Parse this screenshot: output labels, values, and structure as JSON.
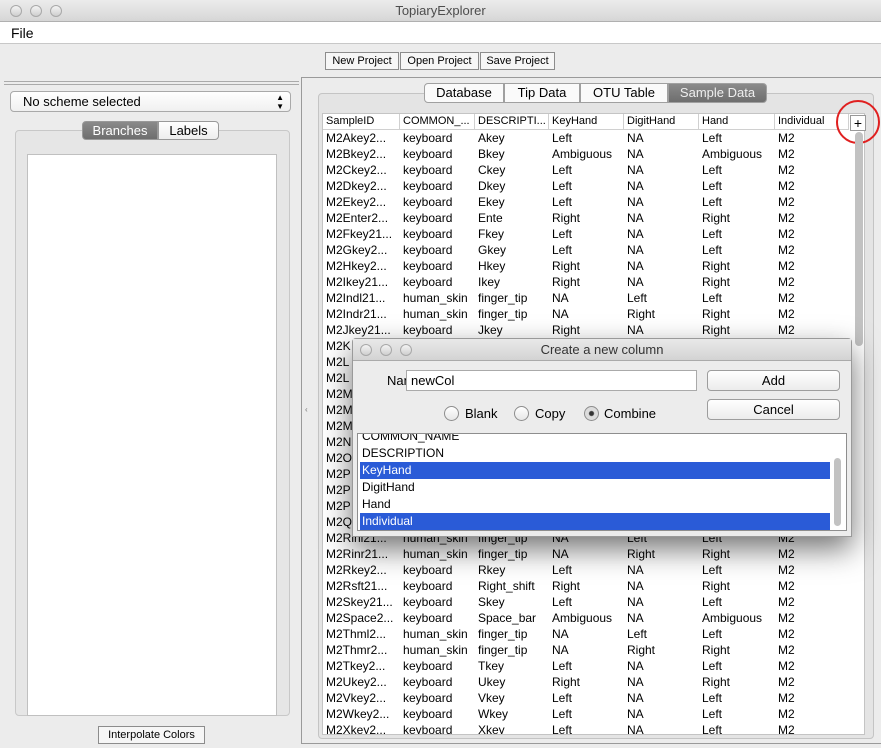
{
  "window": {
    "title": "TopiaryExplorer"
  },
  "menu": {
    "file": "File"
  },
  "toolbar": {
    "new_project": "New Project",
    "open_project": "Open Project",
    "save_project": "Save Project"
  },
  "left": {
    "scheme_select": "No scheme selected",
    "tabs": {
      "branches": "Branches",
      "labels": "Labels"
    },
    "active_tab": "Branches",
    "interpolate": "Interpolate Colors"
  },
  "right": {
    "tabs": [
      "Database",
      "Tip Data",
      "OTU Table",
      "Sample Data"
    ],
    "active_tab": "Sample Data",
    "add_column": "+"
  },
  "table": {
    "columns": [
      "SampleID",
      "COMMON_...",
      "DESCRIPTI...",
      "KeyHand",
      "DigitHand",
      "Hand",
      "Individual"
    ],
    "rows": [
      [
        "M2Akey2...",
        "keyboard",
        "Akey",
        "Left",
        "NA",
        "Left",
        "M2"
      ],
      [
        "M2Bkey2...",
        "keyboard",
        "Bkey",
        "Ambiguous",
        "NA",
        "Ambiguous",
        "M2"
      ],
      [
        "M2Ckey2...",
        "keyboard",
        "Ckey",
        "Left",
        "NA",
        "Left",
        "M2"
      ],
      [
        "M2Dkey2...",
        "keyboard",
        "Dkey",
        "Left",
        "NA",
        "Left",
        "M2"
      ],
      [
        "M2Ekey2...",
        "keyboard",
        "Ekey",
        "Left",
        "NA",
        "Left",
        "M2"
      ],
      [
        "M2Enter2...",
        "keyboard",
        "Ente",
        "Right",
        "NA",
        "Right",
        "M2"
      ],
      [
        "M2Fkey21...",
        "keyboard",
        "Fkey",
        "Left",
        "NA",
        "Left",
        "M2"
      ],
      [
        "M2Gkey2...",
        "keyboard",
        "Gkey",
        "Left",
        "NA",
        "Left",
        "M2"
      ],
      [
        "M2Hkey2...",
        "keyboard",
        "Hkey",
        "Right",
        "NA",
        "Right",
        "M2"
      ],
      [
        "M2Ikey21...",
        "keyboard",
        "Ikey",
        "Right",
        "NA",
        "Right",
        "M2"
      ],
      [
        "M2Indl21...",
        "human_skin",
        "finger_tip",
        "NA",
        "Left",
        "Left",
        "M2"
      ],
      [
        "M2Indr21...",
        "human_skin",
        "finger_tip",
        "NA",
        "Right",
        "Right",
        "M2"
      ],
      [
        "M2Jkey21...",
        "keyboard",
        "Jkey",
        "Right",
        "NA",
        "Right",
        "M2"
      ],
      [
        "M2K"
      ],
      [
        "M2L"
      ],
      [
        "M2L"
      ],
      [
        "M2M"
      ],
      [
        "M2M"
      ],
      [
        "M2M"
      ],
      [
        "M2N"
      ],
      [
        "M2O"
      ],
      [
        "M2P"
      ],
      [
        "M2P"
      ],
      [
        "M2P"
      ],
      [
        "M2Q"
      ],
      [
        "M2Rinl21...",
        "human_skin",
        "finger_tip",
        "NA",
        "Left",
        "Left",
        "M2"
      ],
      [
        "M2Rinr21...",
        "human_skin",
        "finger_tip",
        "NA",
        "Right",
        "Right",
        "M2"
      ],
      [
        "M2Rkey2...",
        "keyboard",
        "Rkey",
        "Left",
        "NA",
        "Left",
        "M2"
      ],
      [
        "M2Rsft21...",
        "keyboard",
        "Right_shift",
        "Right",
        "NA",
        "Right",
        "M2"
      ],
      [
        "M2Skey21...",
        "keyboard",
        "Skey",
        "Left",
        "NA",
        "Left",
        "M2"
      ],
      [
        "M2Space2...",
        "keyboard",
        "Space_bar",
        "Ambiguous",
        "NA",
        "Ambiguous",
        "M2"
      ],
      [
        "M2Thml2...",
        "human_skin",
        "finger_tip",
        "NA",
        "Left",
        "Left",
        "M2"
      ],
      [
        "M2Thmr2...",
        "human_skin",
        "finger_tip",
        "NA",
        "Right",
        "Right",
        "M2"
      ],
      [
        "M2Tkey2...",
        "keyboard",
        "Tkey",
        "Left",
        "NA",
        "Left",
        "M2"
      ],
      [
        "M2Ukey2...",
        "keyboard",
        "Ukey",
        "Right",
        "NA",
        "Right",
        "M2"
      ],
      [
        "M2Vkey2...",
        "keyboard",
        "Vkey",
        "Left",
        "NA",
        "Left",
        "M2"
      ],
      [
        "M2Wkey2...",
        "keyboard",
        "Wkey",
        "Left",
        "NA",
        "Left",
        "M2"
      ],
      [
        "M2Xkey2...",
        "keyboard",
        "Xkey",
        "Left",
        "NA",
        "Left",
        "M2"
      ]
    ]
  },
  "dialog": {
    "title": "Create a new column",
    "name_label": "Name:",
    "name_value": "newCol",
    "add": "Add",
    "cancel": "Cancel",
    "options": [
      "Blank",
      "Copy",
      "Combine"
    ],
    "selected_option": "Combine",
    "list": [
      "COMMON_NAME",
      "DESCRIPTION",
      "KeyHand",
      "DigitHand",
      "Hand",
      "Individual"
    ],
    "selected_items": [
      "KeyHand",
      "Individual"
    ]
  },
  "colors": {
    "selection": "#2a5bd7",
    "highlight_circle": "#e02020"
  }
}
